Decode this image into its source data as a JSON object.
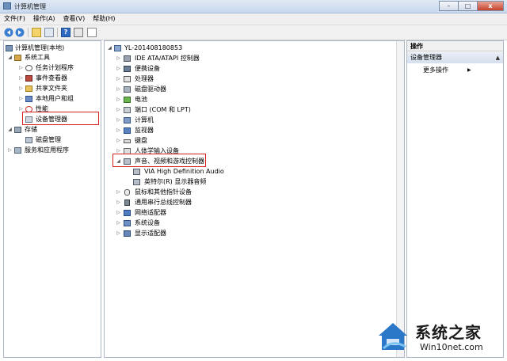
{
  "window": {
    "title": "计算机管理",
    "controls": {
      "minimize": "–",
      "maximize": "□",
      "close": "x"
    }
  },
  "menu": [
    "文件(F)",
    "操作(A)",
    "查看(V)",
    "帮助(H)"
  ],
  "toolbar": {
    "help_glyph": "?"
  },
  "left_tree": [
    {
      "label": "计算机管理(本地)",
      "icon": "computer-management-icon",
      "level": 0,
      "twisty": ""
    },
    {
      "label": "系统工具",
      "icon": "tools-icon",
      "level": 1,
      "twisty": "◢"
    },
    {
      "label": "任务计划程序",
      "icon": "clock-icon",
      "level": 2,
      "twisty": "▷"
    },
    {
      "label": "事件查看器",
      "icon": "event-viewer-icon",
      "level": 2,
      "twisty": "▷"
    },
    {
      "label": "共享文件夹",
      "icon": "shared-folder-icon",
      "level": 2,
      "twisty": "▷"
    },
    {
      "label": "本地用户和组",
      "icon": "users-icon",
      "level": 2,
      "twisty": "▷"
    },
    {
      "label": "性能",
      "icon": "performance-icon",
      "level": 2,
      "twisty": "▷"
    },
    {
      "label": "设备管理器",
      "icon": "device-manager-icon",
      "level": 2,
      "twisty": ""
    },
    {
      "label": "存储",
      "icon": "storage-icon",
      "level": 1,
      "twisty": "◢"
    },
    {
      "label": "磁盘管理",
      "icon": "disk-icon",
      "level": 2,
      "twisty": ""
    },
    {
      "label": "服务和应用程序",
      "icon": "services-icon",
      "level": 1,
      "twisty": "▷"
    }
  ],
  "device_tree": {
    "root": "YL-201408180853",
    "items": [
      {
        "label": "IDE ATA/ATAPI 控制器",
        "icon": "ide-controller-icon",
        "level": 1,
        "twisty": "▷"
      },
      {
        "label": "便携设备",
        "icon": "portable-device-icon",
        "level": 1,
        "twisty": "▷"
      },
      {
        "label": "处理器",
        "icon": "processor-icon",
        "level": 1,
        "twisty": "▷"
      },
      {
        "label": "磁盘驱动器",
        "icon": "disk-drive-icon",
        "level": 1,
        "twisty": "▷"
      },
      {
        "label": "电池",
        "icon": "battery-icon",
        "level": 1,
        "twisty": "▷"
      },
      {
        "label": "端口 (COM 和 LPT)",
        "icon": "port-icon",
        "level": 1,
        "twisty": "▷"
      },
      {
        "label": "计算机",
        "icon": "computer-icon",
        "level": 1,
        "twisty": "▷"
      },
      {
        "label": "监视器",
        "icon": "monitor-icon",
        "level": 1,
        "twisty": "▷"
      },
      {
        "label": "键盘",
        "icon": "keyboard-icon",
        "level": 1,
        "twisty": "▷"
      },
      {
        "label": "人体学输入设备",
        "icon": "hid-icon",
        "level": 1,
        "twisty": "▷"
      },
      {
        "label": "声音、视频和游戏控制器",
        "icon": "sound-icon",
        "level": 1,
        "twisty": "◢"
      },
      {
        "label": "VIA High Definition Audio",
        "icon": "audio-device-icon",
        "level": 2,
        "twisty": ""
      },
      {
        "label": "英特尔(R) 显示器音频",
        "icon": "audio-device-icon",
        "level": 2,
        "twisty": ""
      },
      {
        "label": "鼠标和其他指针设备",
        "icon": "mouse-icon",
        "level": 1,
        "twisty": "▷"
      },
      {
        "label": "通用串行总线控制器",
        "icon": "usb-icon",
        "level": 1,
        "twisty": "▷"
      },
      {
        "label": "网络适配器",
        "icon": "network-adapter-icon",
        "level": 1,
        "twisty": "▷"
      },
      {
        "label": "系统设备",
        "icon": "system-device-icon",
        "level": 1,
        "twisty": "▷"
      },
      {
        "label": "显示适配器",
        "icon": "display-adapter-icon",
        "level": 1,
        "twisty": "▷"
      }
    ]
  },
  "actions": {
    "header": "操作",
    "group": "设备管理器",
    "group_arrow": "▲",
    "more": "更多操作",
    "more_arrow": "▶"
  },
  "watermark": {
    "title": "系统之家",
    "url": "Win10net.com"
  }
}
